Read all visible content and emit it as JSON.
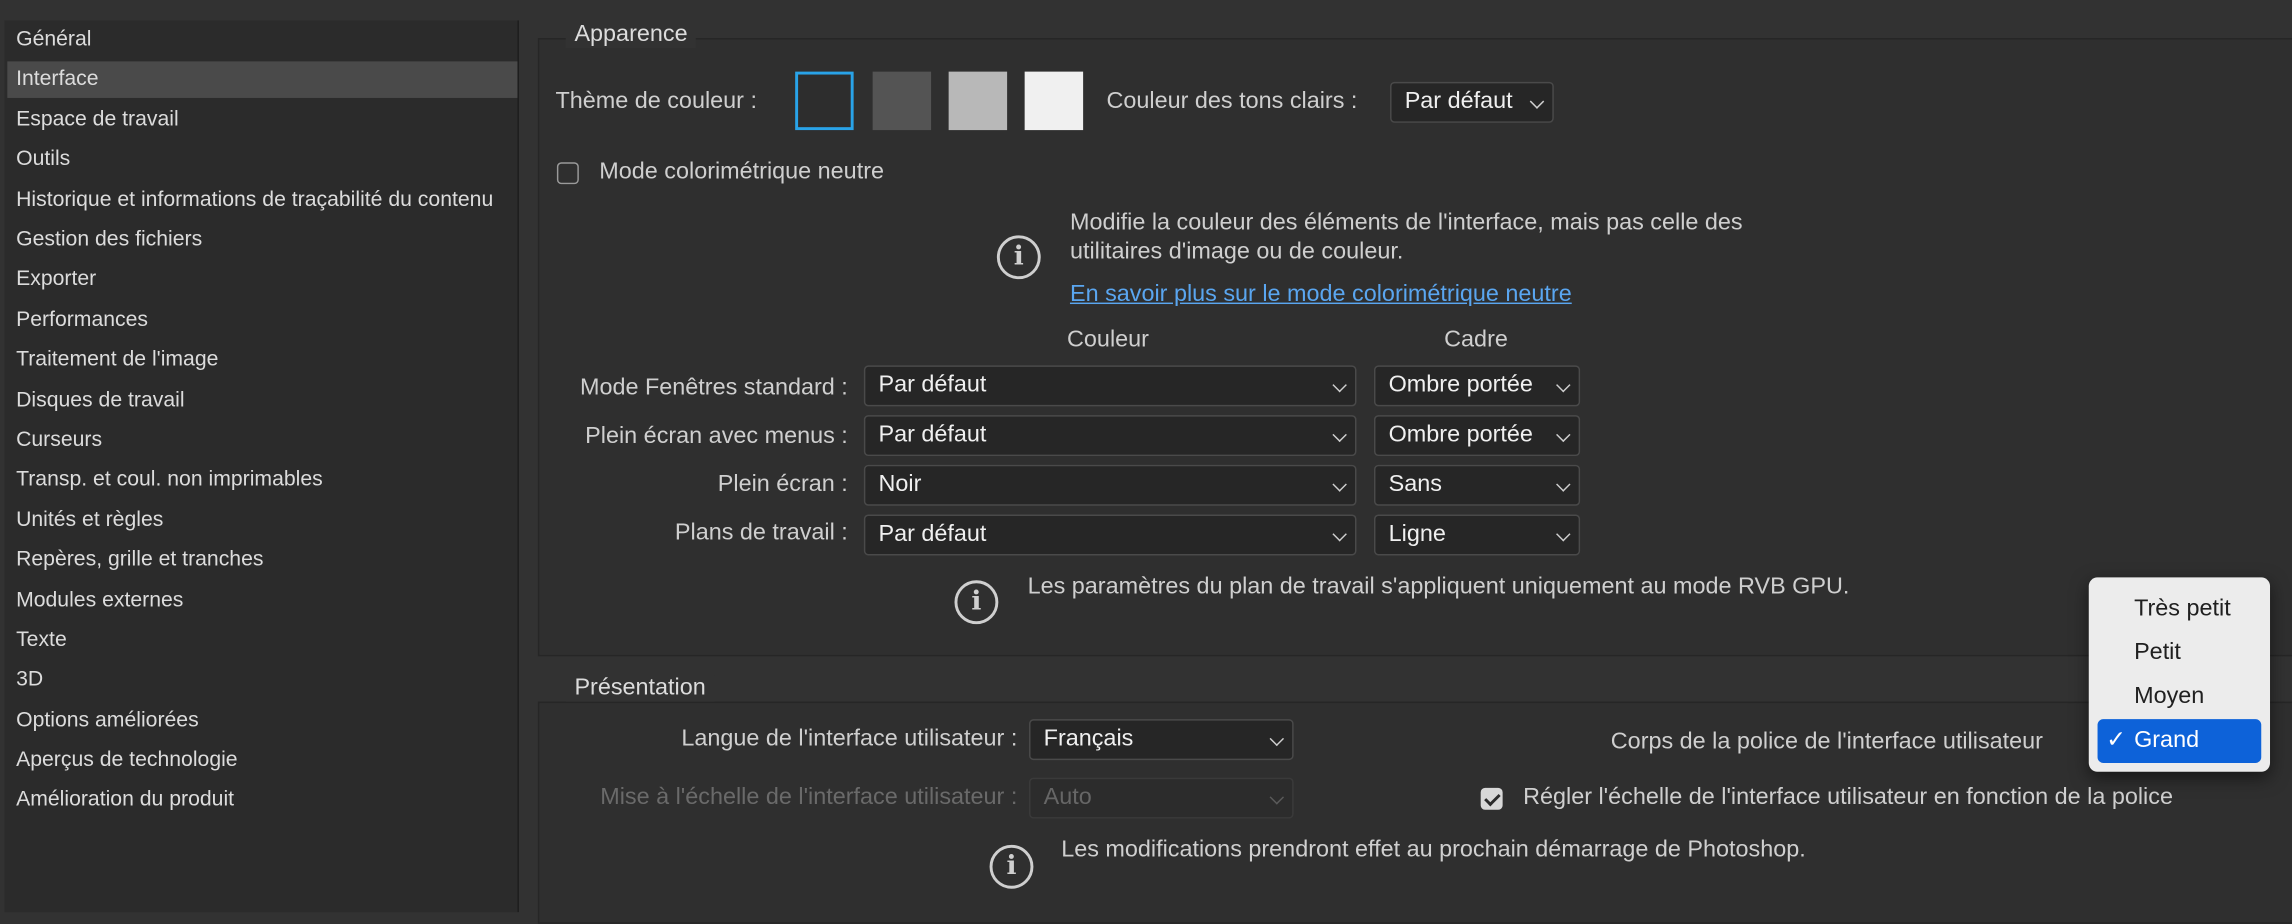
{
  "sidebar": {
    "items": [
      {
        "label": "Général"
      },
      {
        "label": "Interface",
        "selected": true
      },
      {
        "label": "Espace de travail"
      },
      {
        "label": "Outils"
      },
      {
        "label": "Historique et informations de traçabilité du contenu"
      },
      {
        "label": "Gestion des fichiers"
      },
      {
        "label": "Exporter"
      },
      {
        "label": "Performances"
      },
      {
        "label": "Traitement de l'image"
      },
      {
        "label": "Disques de travail"
      },
      {
        "label": "Curseurs"
      },
      {
        "label": "Transp. et coul. non imprimables"
      },
      {
        "label": "Unités et règles"
      },
      {
        "label": "Repères, grille et tranches"
      },
      {
        "label": "Modules externes"
      },
      {
        "label": "Texte"
      },
      {
        "label": "3D"
      },
      {
        "label": "Options améliorées"
      },
      {
        "label": "Aperçus de technologie"
      },
      {
        "label": "Amélioration du produit"
      }
    ]
  },
  "appearance": {
    "title": "Apparence",
    "theme_label": "Thème de couleur :",
    "theme_swatches": [
      {
        "color": "#2d2d2d",
        "selected": true
      },
      {
        "color": "#545454"
      },
      {
        "color": "#b8b8b8"
      },
      {
        "color": "#f0f0f0"
      }
    ],
    "highlight_label": "Couleur des tons clairs :",
    "highlight_value": "Par défaut",
    "neutral_mode_label": "Mode colorimétrique neutre",
    "neutral_mode_checked": false,
    "neutral_info_line1": "Modifie la couleur des éléments de l'interface, mais pas celle des",
    "neutral_info_line2": "utilitaires d'image ou de couleur.",
    "neutral_link": "En savoir plus sur le mode colorimétrique neutre",
    "col_couleur": "Couleur",
    "col_cadre": "Cadre",
    "rows": [
      {
        "label": "Mode Fenêtres standard :",
        "couleur": "Par défaut",
        "cadre": "Ombre portée"
      },
      {
        "label": "Plein écran avec menus :",
        "couleur": "Par défaut",
        "cadre": "Ombre portée"
      },
      {
        "label": "Plein écran :",
        "couleur": "Noir",
        "cadre": "Sans"
      },
      {
        "label": "Plans de travail :",
        "couleur": "Par défaut",
        "cadre": "Ligne"
      }
    ],
    "artboard_info": "Les paramètres du plan de travail s'appliquent uniquement au mode RVB GPU."
  },
  "presentation": {
    "title": "Présentation",
    "language_label": "Langue de l'interface utilisateur :",
    "language_value": "Français",
    "scale_label": "Mise à l'échelle de l'interface utilisateur :",
    "scale_value": "Auto",
    "font_size_label": "Corps de la police de l'interface utilisateur",
    "scale_with_font_label": "Régler l'échelle de l'interface utilisateur en fonction de la police",
    "scale_with_font_checked": true,
    "restart_info": "Les modifications prendront effet au prochain démarrage de Photoshop."
  },
  "font_size_menu": {
    "options": [
      "Très petit",
      "Petit",
      "Moyen",
      "Grand"
    ],
    "selected": "Grand",
    "check_mark": "✓"
  },
  "colors": {
    "accent": "#0d62d9",
    "link": "#5aa6f0",
    "selection_border": "#29a3e8"
  }
}
